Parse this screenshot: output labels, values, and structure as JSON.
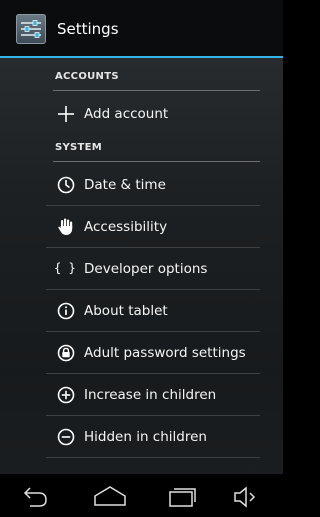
{
  "action_bar": {
    "title": "Settings",
    "icon": "settings-sliders-icon",
    "accent_color": "#33b5e5"
  },
  "sections": [
    {
      "header": "ACCOUNTS",
      "items": [
        {
          "label": "Add account",
          "icon": "plus-icon"
        }
      ]
    },
    {
      "header": "SYSTEM",
      "items": [
        {
          "label": "Date & time",
          "icon": "clock-icon"
        },
        {
          "label": "Accessibility",
          "icon": "hand-icon"
        },
        {
          "label": "Developer options",
          "icon": "braces-icon",
          "glyph": "{ }"
        },
        {
          "label": "About tablet",
          "icon": "info-icon"
        },
        {
          "label": "Adult password settings",
          "icon": "lock-icon"
        },
        {
          "label": "Increase in children",
          "icon": "plus-circle-icon"
        },
        {
          "label": "Hidden in children",
          "icon": "minus-circle-icon"
        }
      ]
    }
  ],
  "nav_bar": {
    "buttons": [
      "back-icon",
      "home-icon",
      "recent-apps-icon",
      "volume-icon"
    ]
  }
}
